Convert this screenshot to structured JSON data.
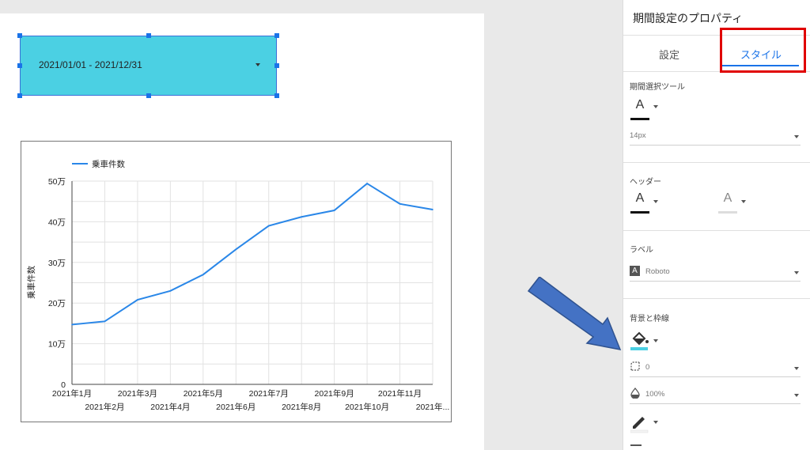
{
  "date_range_control": {
    "value": "2021/01/01 - 2021/12/31"
  },
  "chart_data": {
    "type": "line",
    "x": [
      "2021年1月",
      "2021年2月",
      "2021年3月",
      "2021年4月",
      "2021年5月",
      "2021年6月",
      "2021年7月",
      "2021年8月",
      "2021年9月",
      "2021年10月",
      "2021年11月",
      "2021年..."
    ],
    "series": [
      {
        "name": "乗車件数",
        "values": [
          147000,
          155000,
          208000,
          230000,
          270000,
          332000,
          390000,
          412000,
          428000,
          494000,
          444000,
          430000
        ]
      }
    ],
    "ylabel": "乗車件数",
    "ylim": [
      0,
      500000
    ],
    "y_ticks": [
      0,
      100000,
      200000,
      300000,
      400000,
      500000
    ],
    "y_tick_labels": [
      "0",
      "10万",
      "20万",
      "30万",
      "40万",
      "50万"
    ],
    "legend_position": "top-left",
    "grid": true,
    "line_color": "#2a87e8"
  },
  "panel": {
    "title": "期間設定のプロパティ",
    "tabs": {
      "settings": "設定",
      "style": "スタイル"
    },
    "sections": {
      "period_selector": {
        "title": "期間選択ツール",
        "font_size": "14px"
      },
      "header": {
        "title": "ヘッダー"
      },
      "label": {
        "title": "ラベル",
        "font": "Roboto"
      },
      "background_border": {
        "title": "背景と枠線",
        "border_radius": "0",
        "opacity": "100%"
      }
    },
    "font_glyph": "A",
    "font_icon_glyph": "A"
  },
  "colors": {
    "control_bg": "#4bd0e3",
    "accent": "#1a73e8",
    "highlight": "#e00000",
    "arrow": "#4472c4"
  }
}
